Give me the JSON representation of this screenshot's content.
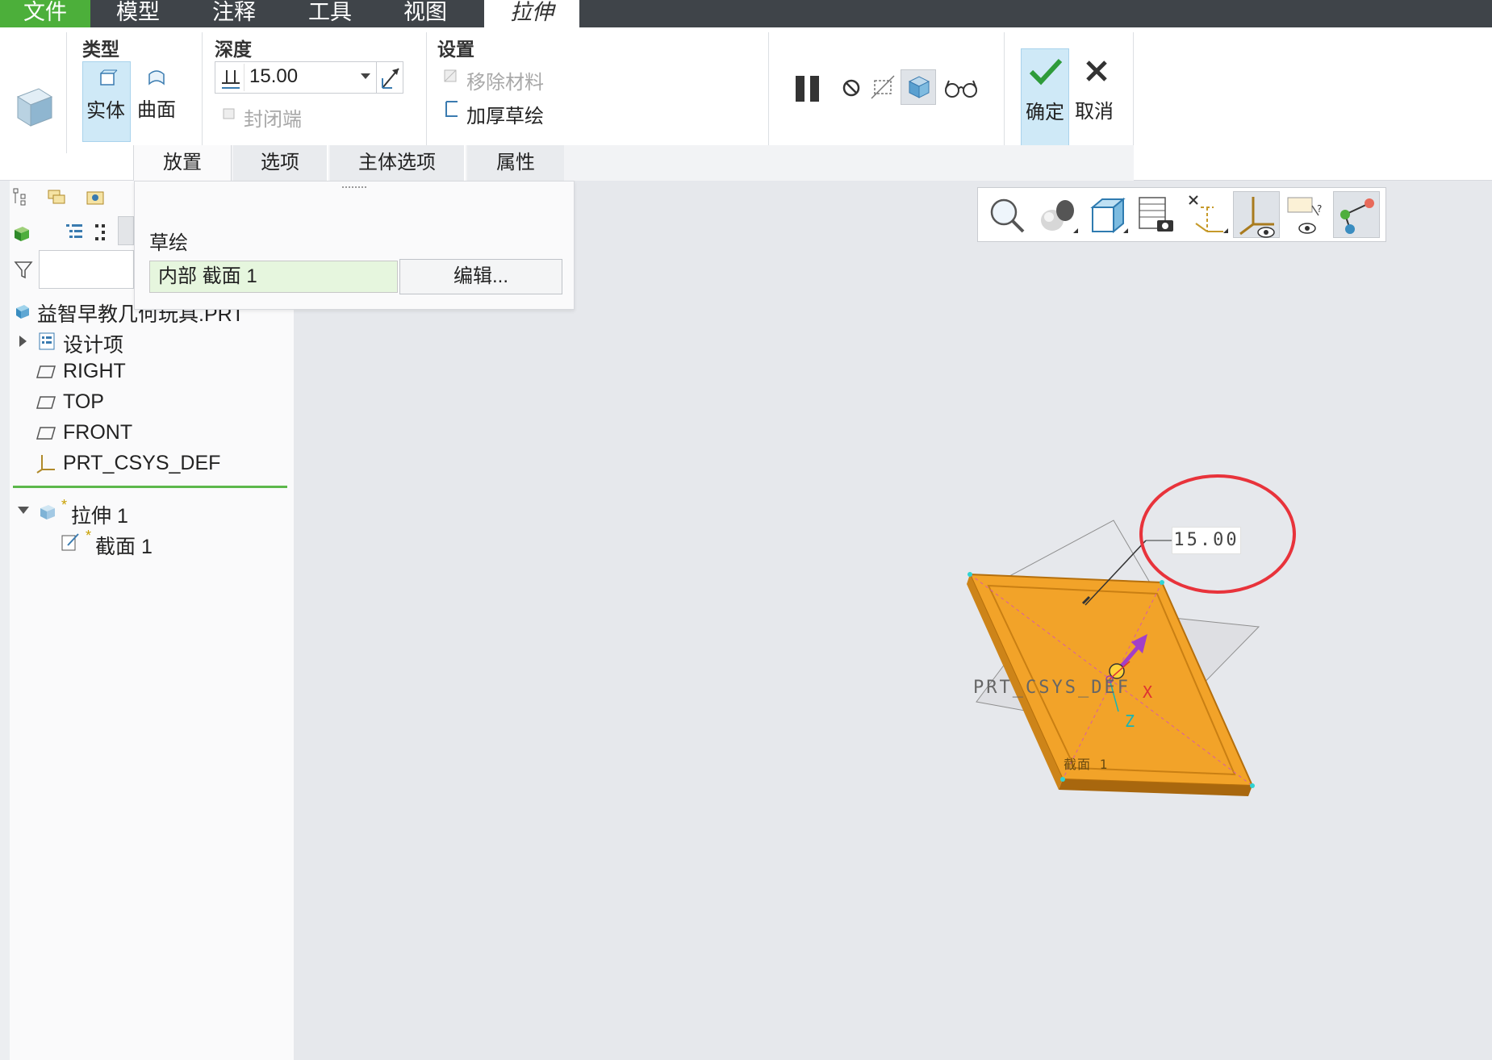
{
  "menu": {
    "file": "文件",
    "model": "模型",
    "annotate": "注释",
    "tools": "工具",
    "view": "视图",
    "extrude": "拉伸"
  },
  "ribbon": {
    "type_label": "类型",
    "solid_label": "实体",
    "surface_label": "曲面",
    "depth_label": "深度",
    "depth_value": "15.00",
    "capped_ends_label": "封闭端",
    "settings_label": "设置",
    "remove_material_label": "移除材料",
    "thicken_sketch_label": "加厚草绘",
    "ok_label": "确定",
    "cancel_label": "取消"
  },
  "dashboard_tabs": [
    "放置",
    "选项",
    "主体选项",
    "属性"
  ],
  "placement": {
    "sketch_label": "草绘",
    "sketch_value": "内部 截面 1",
    "edit_button": "编辑..."
  },
  "tree": {
    "root": "益智早教几何玩具.PRT",
    "items": [
      "设计项",
      "RIGHT",
      "TOP",
      "FRONT",
      "PRT_CSYS_DEF"
    ],
    "feature": "拉伸 1",
    "section": "截面 1",
    "new_marker": "*"
  },
  "viewport": {
    "dimension_value": "15.00",
    "csys_label": "PRT_CSYS_DEF",
    "axis_x": "X",
    "axis_z": "Z",
    "section_tag": "截面 1"
  },
  "icons": {
    "extrude": "extrude-icon",
    "solid": "solid-icon",
    "surface": "surface-icon",
    "pause": "pause-icon",
    "no_preview": "no-preview-icon",
    "preview": "preview-icon",
    "verify": "glasses-icon",
    "ok": "checkmark-icon",
    "cancel": "x-icon",
    "zoom": "zoom-icon",
    "display_style": "display-style-icon",
    "saved_views": "saved-views-icon",
    "view_manager": "view-manager-icon",
    "datum_display": "datum-display-icon",
    "csys_display": "csys-display-icon",
    "annotation_display": "annotation-display-icon",
    "spin_center": "spin-center-icon"
  },
  "colors": {
    "menubar": "#3f4449",
    "file_tab": "#4caf3a",
    "model_orange": "#f0a020",
    "selection_blue": "#cfe9f7",
    "highlight_circle": "#e8333b"
  }
}
